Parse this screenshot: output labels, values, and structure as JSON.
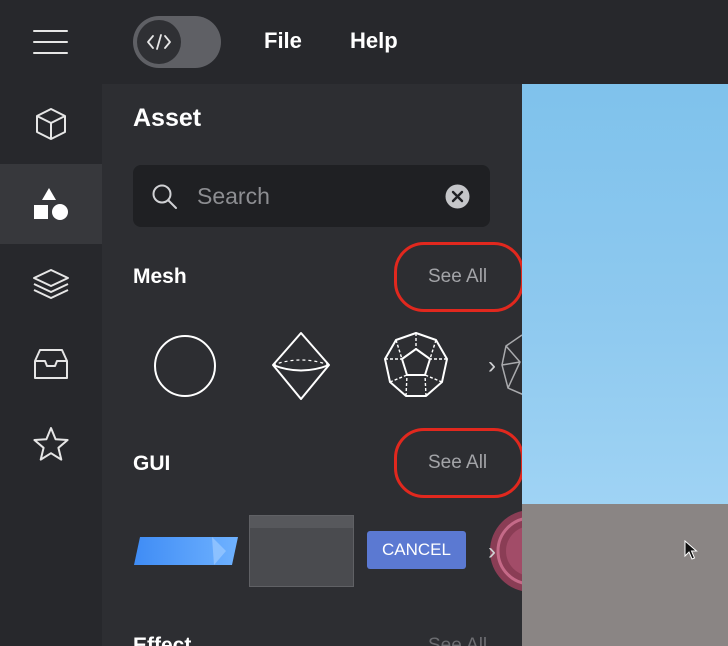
{
  "menu": {
    "file": "File",
    "help": "Help"
  },
  "sidebar": {
    "items": [
      {
        "name": "cube",
        "active": false
      },
      {
        "name": "shapes",
        "active": true
      },
      {
        "name": "layers",
        "active": false
      },
      {
        "name": "inbox",
        "active": false
      },
      {
        "name": "star",
        "active": false
      }
    ]
  },
  "panel": {
    "title": "Asset",
    "search": {
      "placeholder": "Search",
      "value": ""
    },
    "sections": {
      "mesh": {
        "title": "Mesh",
        "see_all": "See All"
      },
      "gui": {
        "title": "GUI",
        "see_all": "See All",
        "cancel_label": "CANCEL"
      },
      "effect": {
        "title": "Effect",
        "see_all": "See All"
      }
    }
  },
  "colors": {
    "background": "#27282c",
    "panel": "#2d2e32",
    "highlight_circle": "#e1281e",
    "cancel_button": "#5b79d2",
    "sky": "#8ec9ef",
    "ground": "#8a8584"
  }
}
